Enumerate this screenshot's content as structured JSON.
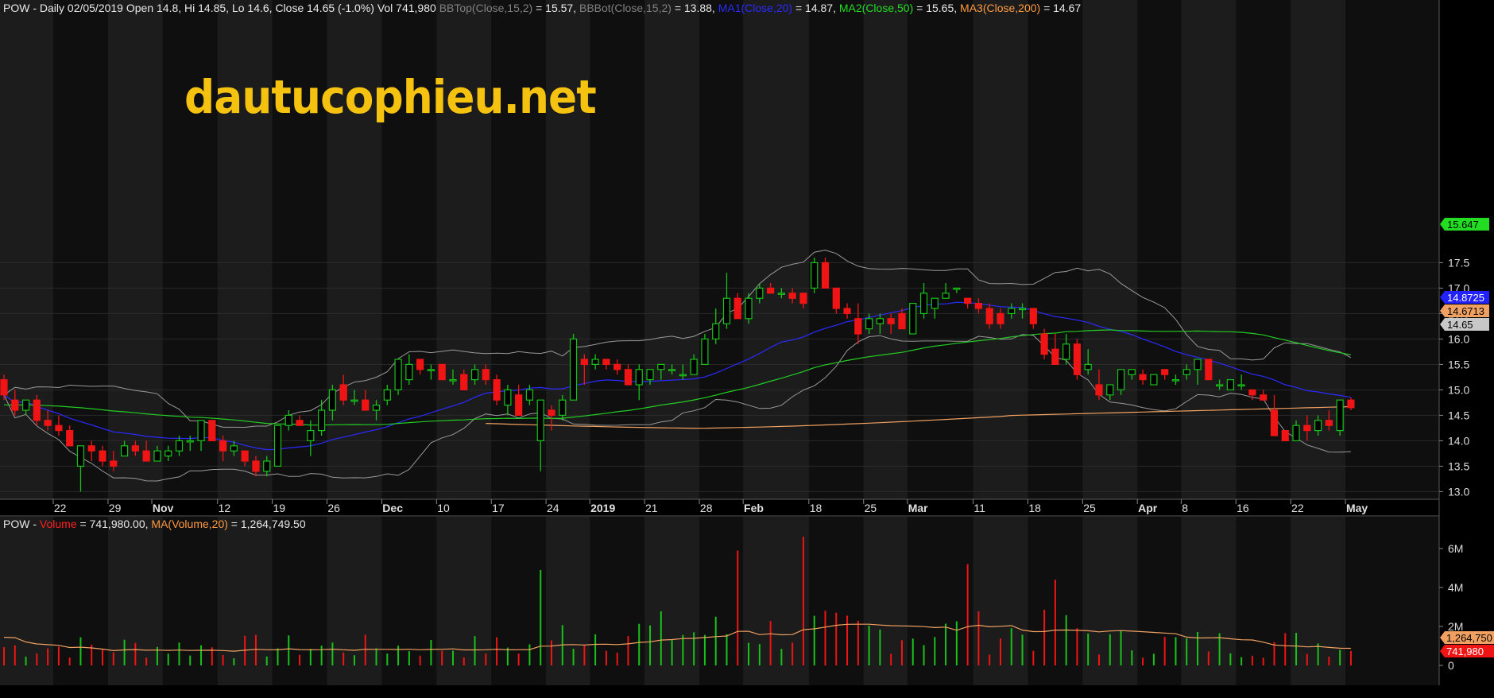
{
  "header": {
    "ticker": "POW",
    "info": " - Daily 02/05/2019 Open 14.8, Hi 14.85, Lo 14.6, Close 14.65 (-1.0%) Vol 741,980 ",
    "bbtop_label": "BBTop(Close,15,2)",
    "bbtop_value": " = 15.57, ",
    "bbbot_label": "BBBot(Close,15,2)",
    "bbbot_value": " = 13.88, ",
    "ma1_label": "MA1(Close,20)",
    "ma1_value": " = 14.87, ",
    "ma2_label": "MA2(Close,50)",
    "ma2_value": " = 15.65, ",
    "ma3_label": "MA3(Close,200)",
    "ma3_value": " = 14.67"
  },
  "volume_header": {
    "ticker": "POW",
    "sep": " - ",
    "vol_label": "Volume",
    "vol_value": " = 741,980.00, ",
    "ma_label": "MA(Volume,20)",
    "ma_value": " = 1,264,749.50"
  },
  "watermark": "dautucophieu.net",
  "colors": {
    "background": "#000000",
    "band_dark": "#0f0f0f",
    "band_light": "#1c1c1c",
    "up": "#19c219",
    "down": "#f01414",
    "bb": "#9a9a9a",
    "ma1": "#2a2aff",
    "ma2": "#22cc22",
    "ma3": "#f0a060",
    "vol_ma": "#f0a060",
    "watermark": "#f5c20f"
  },
  "chart_data": [
    {
      "type": "candlestick",
      "title": "POW - Daily",
      "y_ticks": [
        "13.0",
        "13.5",
        "14.0",
        "14.5",
        "15.0",
        "15.5",
        "16.0",
        "16.5",
        "17.0",
        "17.5"
      ],
      "ylim": [
        12.85,
        17.75
      ],
      "x_labels": [
        {
          "i": 5,
          "t": "22"
        },
        {
          "i": 10,
          "t": "29"
        },
        {
          "i": 14,
          "t": "Nov"
        },
        {
          "i": 20,
          "t": "12"
        },
        {
          "i": 25,
          "t": "19"
        },
        {
          "i": 30,
          "t": "26"
        },
        {
          "i": 35,
          "t": "Dec"
        },
        {
          "i": 40,
          "t": "10"
        },
        {
          "i": 45,
          "t": "17"
        },
        {
          "i": 50,
          "t": "24"
        },
        {
          "i": 54,
          "t": "2019"
        },
        {
          "i": 59,
          "t": "21"
        },
        {
          "i": 64,
          "t": "28"
        },
        {
          "i": 68,
          "t": "Feb"
        },
        {
          "i": 74,
          "t": "18"
        },
        {
          "i": 79,
          "t": "25"
        },
        {
          "i": 83,
          "t": "Mar"
        },
        {
          "i": 89,
          "t": "11"
        },
        {
          "i": 94,
          "t": "18"
        },
        {
          "i": 99,
          "t": "25"
        },
        {
          "i": 104,
          "t": "Apr"
        },
        {
          "i": 108,
          "t": "8"
        },
        {
          "i": 113,
          "t": "16"
        },
        {
          "i": 118,
          "t": "22"
        },
        {
          "i": 123,
          "t": "May"
        }
      ],
      "candles": [
        [
          15.2,
          15.3,
          14.8,
          14.9
        ],
        [
          14.8,
          15.0,
          14.5,
          14.6
        ],
        [
          14.6,
          14.8,
          14.5,
          14.8
        ],
        [
          14.8,
          14.9,
          14.3,
          14.4
        ],
        [
          14.4,
          14.6,
          14.2,
          14.3
        ],
        [
          14.3,
          14.5,
          14.1,
          14.2
        ],
        [
          14.2,
          14.3,
          13.9,
          13.9
        ],
        [
          13.5,
          13.9,
          13.0,
          13.9
        ],
        [
          13.9,
          14.0,
          13.6,
          13.8
        ],
        [
          13.8,
          13.9,
          13.5,
          13.6
        ],
        [
          13.6,
          13.8,
          13.4,
          13.5
        ],
        [
          13.7,
          14.0,
          13.7,
          13.9
        ],
        [
          13.9,
          14.0,
          13.7,
          13.8
        ],
        [
          13.8,
          14.0,
          13.6,
          13.6
        ],
        [
          13.6,
          13.9,
          13.6,
          13.8
        ],
        [
          13.7,
          13.9,
          13.6,
          13.8
        ],
        [
          13.8,
          14.1,
          13.7,
          14.0
        ],
        [
          14.0,
          14.1,
          13.8,
          14.0
        ],
        [
          14.0,
          14.4,
          13.8,
          14.4
        ],
        [
          14.4,
          14.4,
          14.0,
          14.0
        ],
        [
          14.0,
          14.1,
          13.6,
          13.8
        ],
        [
          13.8,
          14.0,
          13.7,
          13.9
        ],
        [
          13.8,
          13.8,
          13.5,
          13.6
        ],
        [
          13.6,
          13.7,
          13.3,
          13.4
        ],
        [
          13.4,
          13.7,
          13.3,
          13.6
        ],
        [
          13.5,
          14.3,
          13.5,
          14.3
        ],
        [
          14.3,
          14.6,
          14.2,
          14.5
        ],
        [
          14.4,
          14.5,
          14.3,
          14.3
        ],
        [
          14.0,
          14.4,
          13.7,
          14.2
        ],
        [
          14.2,
          14.8,
          14.1,
          14.6
        ],
        [
          14.6,
          15.1,
          14.4,
          15.0
        ],
        [
          15.1,
          15.3,
          14.7,
          14.8
        ],
        [
          14.8,
          15.0,
          14.7,
          14.8
        ],
        [
          14.8,
          15.0,
          14.6,
          14.6
        ],
        [
          14.6,
          14.8,
          14.4,
          14.7
        ],
        [
          14.8,
          15.1,
          14.7,
          15.0
        ],
        [
          15.0,
          15.6,
          14.9,
          15.6
        ],
        [
          15.2,
          15.7,
          15.1,
          15.5
        ],
        [
          15.6,
          15.6,
          15.3,
          15.4
        ],
        [
          15.4,
          15.5,
          15.2,
          15.4
        ],
        [
          15.5,
          15.5,
          15.2,
          15.2
        ],
        [
          15.2,
          15.4,
          15.1,
          15.2
        ],
        [
          15.3,
          15.4,
          15.0,
          15.0
        ],
        [
          15.2,
          15.5,
          15.1,
          15.4
        ],
        [
          15.4,
          15.5,
          15.1,
          15.2
        ],
        [
          15.2,
          15.3,
          14.7,
          14.8
        ],
        [
          14.7,
          15.1,
          14.5,
          15.0
        ],
        [
          14.9,
          15.1,
          14.5,
          14.5
        ],
        [
          14.8,
          15.1,
          14.7,
          15.0
        ],
        [
          14.0,
          14.8,
          13.4,
          14.8
        ],
        [
          14.6,
          14.7,
          14.2,
          14.5
        ],
        [
          14.5,
          14.9,
          14.4,
          14.8
        ],
        [
          14.8,
          16.1,
          14.8,
          16.0
        ],
        [
          15.6,
          15.7,
          15.1,
          15.5
        ],
        [
          15.5,
          15.7,
          15.4,
          15.6
        ],
        [
          15.6,
          15.6,
          15.4,
          15.5
        ],
        [
          15.5,
          15.6,
          15.3,
          15.4
        ],
        [
          15.4,
          15.5,
          15.1,
          15.1
        ],
        [
          15.1,
          15.5,
          14.8,
          15.4
        ],
        [
          15.2,
          15.4,
          15.1,
          15.4
        ],
        [
          15.4,
          15.5,
          15.2,
          15.5
        ],
        [
          15.4,
          15.5,
          15.3,
          15.4
        ],
        [
          15.3,
          15.5,
          15.2,
          15.3
        ],
        [
          15.3,
          15.7,
          15.3,
          15.6
        ],
        [
          15.5,
          16.1,
          15.5,
          16.0
        ],
        [
          16.0,
          16.6,
          15.9,
          16.3
        ],
        [
          16.3,
          17.3,
          16.2,
          16.8
        ],
        [
          16.8,
          16.9,
          16.4,
          16.4
        ],
        [
          16.4,
          16.9,
          16.3,
          16.8
        ],
        [
          16.8,
          17.1,
          16.7,
          17.0
        ],
        [
          17.0,
          17.1,
          16.9,
          16.9
        ],
        [
          16.9,
          17.0,
          16.8,
          16.9
        ],
        [
          16.9,
          17.0,
          16.7,
          16.8
        ],
        [
          16.9,
          16.9,
          16.6,
          16.7
        ],
        [
          17.0,
          17.6,
          16.9,
          17.5
        ],
        [
          17.5,
          17.6,
          17.0,
          17.0
        ],
        [
          17.0,
          17.0,
          16.5,
          16.6
        ],
        [
          16.6,
          16.7,
          16.4,
          16.5
        ],
        [
          16.4,
          16.7,
          15.9,
          16.1
        ],
        [
          16.2,
          16.5,
          16.1,
          16.4
        ],
        [
          16.3,
          16.5,
          16.1,
          16.4
        ],
        [
          16.4,
          16.5,
          16.1,
          16.3
        ],
        [
          16.5,
          16.6,
          16.2,
          16.2
        ],
        [
          16.1,
          16.7,
          16.1,
          16.7
        ],
        [
          16.5,
          17.1,
          16.4,
          16.9
        ],
        [
          16.6,
          16.8,
          16.4,
          16.8
        ],
        [
          16.8,
          17.1,
          16.8,
          16.9
        ],
        [
          17.0,
          17.0,
          16.9,
          17.0
        ],
        [
          16.8,
          16.8,
          16.6,
          16.7
        ],
        [
          16.7,
          16.8,
          16.5,
          16.6
        ],
        [
          16.6,
          16.7,
          16.2,
          16.3
        ],
        [
          16.5,
          16.6,
          16.2,
          16.3
        ],
        [
          16.5,
          16.7,
          16.4,
          16.6
        ],
        [
          16.6,
          16.7,
          16.4,
          16.6
        ],
        [
          16.6,
          16.6,
          16.2,
          16.3
        ],
        [
          16.1,
          16.2,
          15.6,
          15.7
        ],
        [
          15.8,
          16.1,
          15.5,
          15.5
        ],
        [
          15.6,
          16.1,
          15.5,
          15.9
        ],
        [
          15.9,
          16.0,
          15.2,
          15.3
        ],
        [
          15.4,
          15.8,
          15.3,
          15.5
        ],
        [
          15.1,
          15.4,
          14.8,
          14.9
        ],
        [
          14.9,
          15.1,
          14.8,
          15.1
        ],
        [
          15.0,
          15.4,
          14.9,
          15.4
        ],
        [
          15.3,
          15.4,
          15.2,
          15.4
        ],
        [
          15.3,
          15.4,
          15.1,
          15.2
        ],
        [
          15.1,
          15.3,
          15.1,
          15.3
        ],
        [
          15.4,
          15.4,
          15.2,
          15.3
        ],
        [
          15.2,
          15.3,
          15.1,
          15.2
        ],
        [
          15.3,
          15.5,
          15.2,
          15.4
        ],
        [
          15.4,
          15.5,
          15.1,
          15.6
        ],
        [
          15.6,
          15.6,
          15.2,
          15.2
        ],
        [
          15.1,
          15.2,
          15.0,
          15.1
        ],
        [
          15.0,
          15.2,
          15.0,
          15.2
        ],
        [
          15.1,
          15.3,
          15.0,
          15.1
        ],
        [
          15.0,
          15.0,
          14.8,
          14.9
        ],
        [
          14.9,
          15.0,
          14.8,
          14.8
        ],
        [
          14.6,
          14.9,
          14.1,
          14.1
        ],
        [
          14.2,
          14.2,
          14.0,
          14.0
        ],
        [
          14.0,
          14.4,
          14.0,
          14.3
        ],
        [
          14.3,
          14.5,
          14.0,
          14.2
        ],
        [
          14.2,
          14.5,
          14.1,
          14.4
        ],
        [
          14.4,
          14.6,
          14.2,
          14.3
        ],
        [
          14.2,
          14.8,
          14.1,
          14.8
        ],
        [
          14.8,
          14.85,
          14.6,
          14.65
        ]
      ],
      "series": [
        {
          "name": "BBTop(Close,15,2)",
          "value": 15.57
        },
        {
          "name": "BBBot(Close,15,2)",
          "value": 13.88
        },
        {
          "name": "MA1(Close,20)",
          "value": 14.87
        },
        {
          "name": "MA2(Close,50)",
          "value": 15.65
        },
        {
          "name": "MA3(Close,200)",
          "value": 14.67
        }
      ],
      "right_labels": [
        {
          "text": "15.647",
          "value": 15.647,
          "bg": "#22dd22",
          "fg": "#000000"
        },
        {
          "text": "14.8725",
          "value": 14.8725,
          "bg": "#2222ff",
          "fg": "#ffffff"
        },
        {
          "text": "14.6713",
          "value": 14.6713,
          "bg": "#f0a060",
          "fg": "#000000"
        },
        {
          "text": "14.65",
          "value": 14.65,
          "bg": "#c8c8c8",
          "fg": "#000000"
        }
      ]
    },
    {
      "type": "bar",
      "title": "POW - Volume",
      "y_ticks": [
        "0",
        "2M",
        "4M",
        "6M"
      ],
      "ylim": [
        0,
        6600000
      ],
      "volume_ma_last": 1264749.5,
      "right_labels": [
        {
          "text": "1,264,750",
          "value": 1264749.5,
          "bg": "#f0a060",
          "fg": "#000000"
        },
        {
          "text": "741,980",
          "value": 741980,
          "bg": "#f01414",
          "fg": "#ffffff"
        }
      ]
    }
  ]
}
